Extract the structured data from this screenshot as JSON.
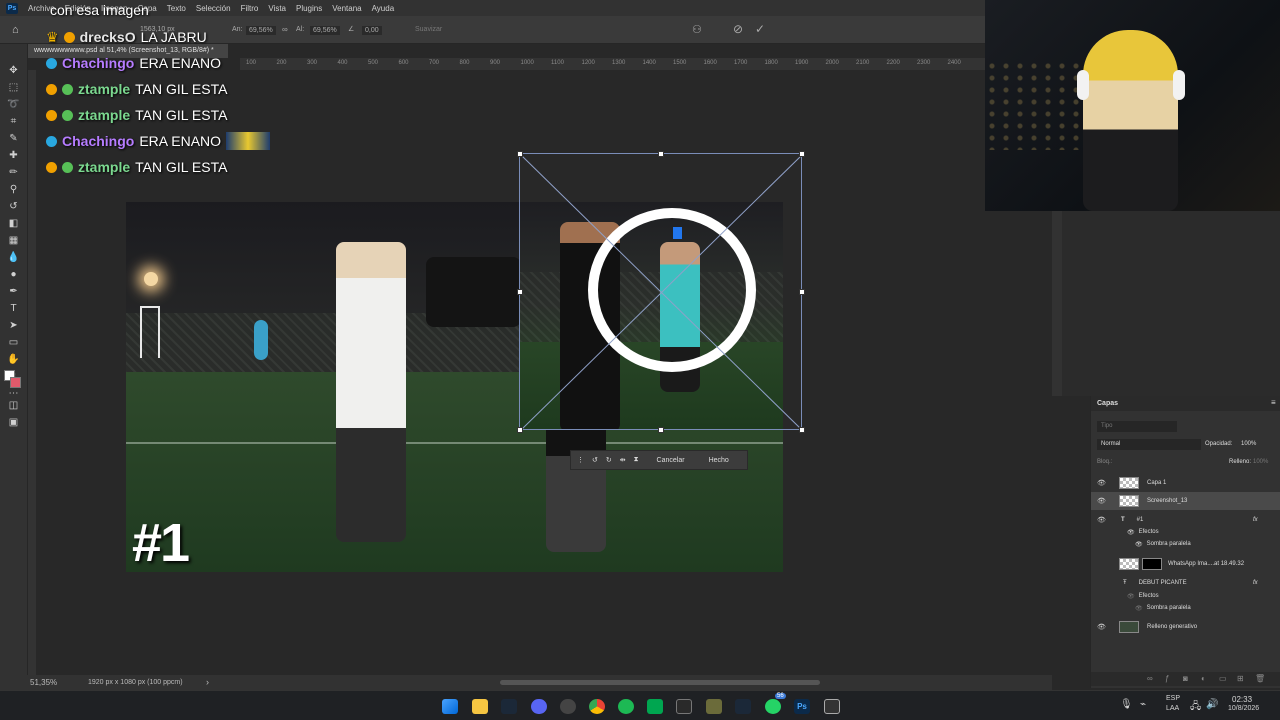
{
  "menu": {
    "items": [
      "Archivo",
      "Edición",
      "Imagen",
      "Capa",
      "Texto",
      "Selección",
      "Filtro",
      "Vista",
      "Plugins",
      "Ventana",
      "Ayuda"
    ]
  },
  "options_bar": {
    "x_value": "1563,10 px",
    "w_label": "An:",
    "w_value": "69,56%",
    "h_label": "Al:",
    "h_value": "69,56%",
    "angle_value": "0,00",
    "interp": "Suavizar"
  },
  "document": {
    "tab_title": "wwwwwwwwww.psd al 51,4% (Screenshot_13, RGB/8#) *",
    "zoom": "51,35%",
    "dimensions": "1920 px x 1080 px (100 ppcm)"
  },
  "ruler": {
    "ticks": [
      "100",
      "200",
      "300",
      "400",
      "500",
      "600",
      "700",
      "800",
      "900",
      "1000",
      "1100",
      "1200",
      "1300",
      "1400",
      "1500",
      "1600",
      "1700",
      "1800",
      "1900",
      "2000",
      "2100",
      "2200",
      "2300",
      "2400"
    ]
  },
  "canvas": {
    "number_label": "#1"
  },
  "transform_bar": {
    "cancel": "Cancelar",
    "done": "Hecho"
  },
  "chat": {
    "caption": "con esa imagen",
    "lines": [
      {
        "user": "drecksO",
        "message": "LA JABRU",
        "color": "#e6e6e6"
      },
      {
        "user": "Chachingo",
        "message": "ERA ENANO",
        "color": "#b67cff"
      },
      {
        "user": "ztample",
        "message": "TAN GIL ESTA",
        "color": "#7bd88f"
      },
      {
        "user": "ztample",
        "message": "TAN GIL ESTA",
        "color": "#7bd88f"
      },
      {
        "user": "Chachingo",
        "message": "ERA ENANO",
        "color": "#b67cff"
      },
      {
        "user": "ztample",
        "message": "TAN GIL ESTA",
        "color": "#7bd88f"
      }
    ]
  },
  "layers_panel": {
    "title": "Capas",
    "search_placeholder": "Tipo",
    "blend_mode": "Normal",
    "opacity_label": "Opacidad:",
    "opacity_value": "100%",
    "lock_label": "Bloq.:",
    "fill_label": "Relleno:",
    "fill_value": "100%",
    "layers": [
      {
        "name": "Capa 1",
        "effects": false
      },
      {
        "name": "Screenshot_13",
        "effects": false
      },
      {
        "name": "#1",
        "effects": true
      },
      {
        "name": "Efectos",
        "effects": false
      },
      {
        "name": "Sombra paralela",
        "effects": false
      },
      {
        "name": "WhatsApp Ima....at 18.49.32",
        "effects": false
      },
      {
        "name": "DEBUT PICANTE",
        "effects": true
      },
      {
        "name": "Efectos",
        "effects": false
      },
      {
        "name": "Sombra paralela",
        "effects": false
      },
      {
        "name": "Relleno generativo",
        "effects": false
      }
    ],
    "fx_label": "fx"
  },
  "taskbar": {
    "lang_top": "ESP",
    "lang_bottom": "LAA",
    "time": "02:33",
    "date": "10/8/2026",
    "badge": "56"
  }
}
